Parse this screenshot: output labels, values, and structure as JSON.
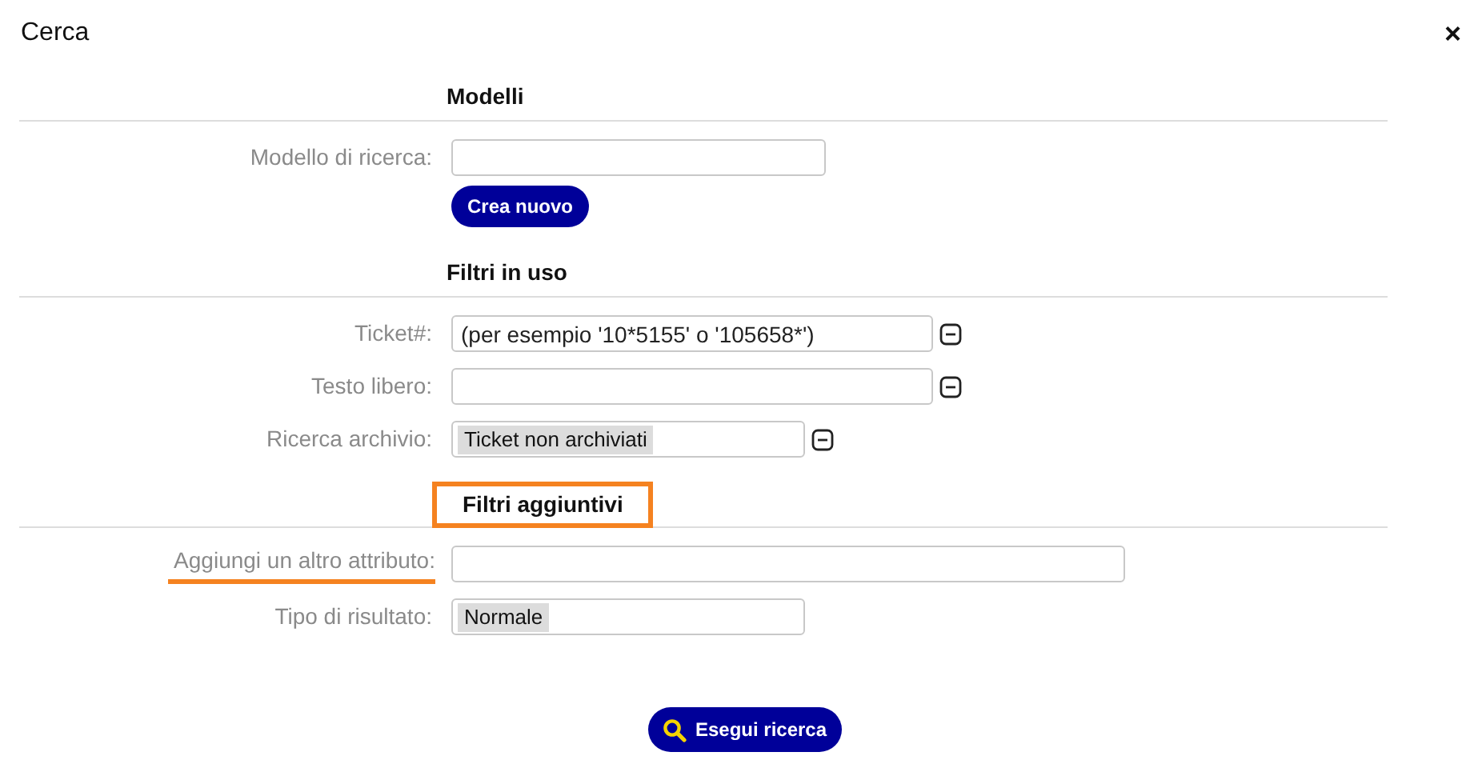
{
  "dialog": {
    "title": "Cerca",
    "close": "×"
  },
  "sections": [
    {
      "heading": "Modelli",
      "highlighted": false,
      "rows": [
        {
          "label": "Modello di ricerca:",
          "kind": "input",
          "underlined": false,
          "removable": false
        }
      ],
      "button": "Crea nuovo"
    },
    {
      "heading": "Filtri in uso",
      "highlighted": false,
      "rows": [
        {
          "label": "Ticket#:",
          "kind": "input",
          "value": "(per esempio '10*5155' o '105658*')",
          "underlined": false,
          "removable": true
        },
        {
          "label": "Testo libero:",
          "kind": "input",
          "underlined": false,
          "removable": true
        },
        {
          "label": "Ricerca archivio:",
          "kind": "select",
          "value": "Ticket non archiviati",
          "underlined": false,
          "removable": true
        }
      ]
    },
    {
      "heading": "Filtri aggiuntivi",
      "highlighted": true,
      "rows": [
        {
          "label": "Aggiungi un altro attributo:",
          "kind": "input",
          "underlined": true,
          "removable": false
        },
        {
          "label": "Tipo di risultato:",
          "kind": "select",
          "value": "Normale",
          "underlined": false,
          "removable": false
        }
      ]
    }
  ],
  "search_button": "Esegui ricerca"
}
